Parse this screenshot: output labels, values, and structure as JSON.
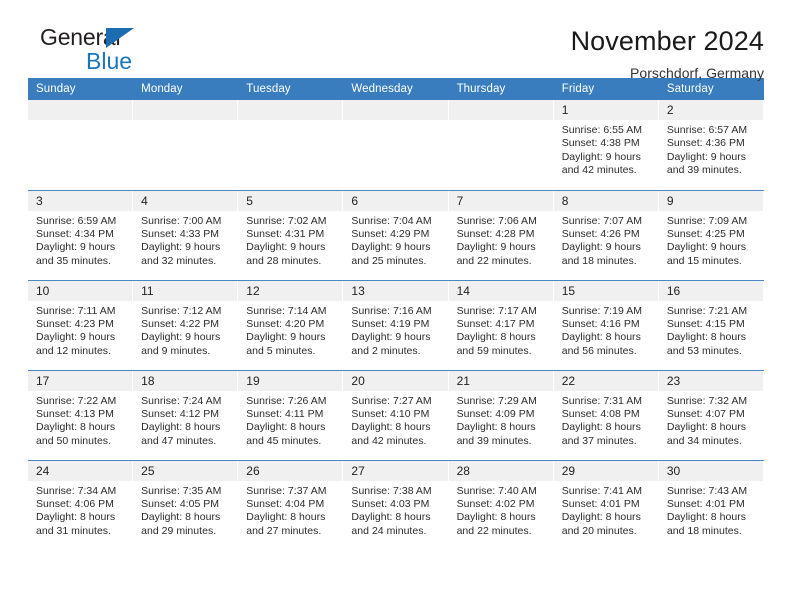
{
  "brand": {
    "name_top": "General",
    "name_bottom": "Blue",
    "accent_color": "#1b75bb"
  },
  "header": {
    "title": "November 2024",
    "subtitle": "Porschdorf, Germany"
  },
  "theme": {
    "header_row_bg": "#3a7dbe",
    "daynum_bg": "#f0f0f0",
    "row_divider": "#4a86c5",
    "text": "#222222"
  },
  "weekday_headers": [
    "Sunday",
    "Monday",
    "Tuesday",
    "Wednesday",
    "Thursday",
    "Friday",
    "Saturday"
  ],
  "labels": {
    "sunrise": "Sunrise:",
    "sunset": "Sunset:",
    "daylight": "Daylight:"
  },
  "weeks": [
    [
      {
        "day": "",
        "blank": true
      },
      {
        "day": "",
        "blank": true
      },
      {
        "day": "",
        "blank": true
      },
      {
        "day": "",
        "blank": true
      },
      {
        "day": "",
        "blank": true
      },
      {
        "day": "1",
        "sunrise": "Sunrise: 6:55 AM",
        "sunset": "Sunset: 4:38 PM",
        "daylight_1": "Daylight: 9 hours",
        "daylight_2": "and 42 minutes."
      },
      {
        "day": "2",
        "sunrise": "Sunrise: 6:57 AM",
        "sunset": "Sunset: 4:36 PM",
        "daylight_1": "Daylight: 9 hours",
        "daylight_2": "and 39 minutes."
      }
    ],
    [
      {
        "day": "3",
        "sunrise": "Sunrise: 6:59 AM",
        "sunset": "Sunset: 4:34 PM",
        "daylight_1": "Daylight: 9 hours",
        "daylight_2": "and 35 minutes."
      },
      {
        "day": "4",
        "sunrise": "Sunrise: 7:00 AM",
        "sunset": "Sunset: 4:33 PM",
        "daylight_1": "Daylight: 9 hours",
        "daylight_2": "and 32 minutes."
      },
      {
        "day": "5",
        "sunrise": "Sunrise: 7:02 AM",
        "sunset": "Sunset: 4:31 PM",
        "daylight_1": "Daylight: 9 hours",
        "daylight_2": "and 28 minutes."
      },
      {
        "day": "6",
        "sunrise": "Sunrise: 7:04 AM",
        "sunset": "Sunset: 4:29 PM",
        "daylight_1": "Daylight: 9 hours",
        "daylight_2": "and 25 minutes."
      },
      {
        "day": "7",
        "sunrise": "Sunrise: 7:06 AM",
        "sunset": "Sunset: 4:28 PM",
        "daylight_1": "Daylight: 9 hours",
        "daylight_2": "and 22 minutes."
      },
      {
        "day": "8",
        "sunrise": "Sunrise: 7:07 AM",
        "sunset": "Sunset: 4:26 PM",
        "daylight_1": "Daylight: 9 hours",
        "daylight_2": "and 18 minutes."
      },
      {
        "day": "9",
        "sunrise": "Sunrise: 7:09 AM",
        "sunset": "Sunset: 4:25 PM",
        "daylight_1": "Daylight: 9 hours",
        "daylight_2": "and 15 minutes."
      }
    ],
    [
      {
        "day": "10",
        "sunrise": "Sunrise: 7:11 AM",
        "sunset": "Sunset: 4:23 PM",
        "daylight_1": "Daylight: 9 hours",
        "daylight_2": "and 12 minutes."
      },
      {
        "day": "11",
        "sunrise": "Sunrise: 7:12 AM",
        "sunset": "Sunset: 4:22 PM",
        "daylight_1": "Daylight: 9 hours",
        "daylight_2": "and 9 minutes."
      },
      {
        "day": "12",
        "sunrise": "Sunrise: 7:14 AM",
        "sunset": "Sunset: 4:20 PM",
        "daylight_1": "Daylight: 9 hours",
        "daylight_2": "and 5 minutes."
      },
      {
        "day": "13",
        "sunrise": "Sunrise: 7:16 AM",
        "sunset": "Sunset: 4:19 PM",
        "daylight_1": "Daylight: 9 hours",
        "daylight_2": "and 2 minutes."
      },
      {
        "day": "14",
        "sunrise": "Sunrise: 7:17 AM",
        "sunset": "Sunset: 4:17 PM",
        "daylight_1": "Daylight: 8 hours",
        "daylight_2": "and 59 minutes."
      },
      {
        "day": "15",
        "sunrise": "Sunrise: 7:19 AM",
        "sunset": "Sunset: 4:16 PM",
        "daylight_1": "Daylight: 8 hours",
        "daylight_2": "and 56 minutes."
      },
      {
        "day": "16",
        "sunrise": "Sunrise: 7:21 AM",
        "sunset": "Sunset: 4:15 PM",
        "daylight_1": "Daylight: 8 hours",
        "daylight_2": "and 53 minutes."
      }
    ],
    [
      {
        "day": "17",
        "sunrise": "Sunrise: 7:22 AM",
        "sunset": "Sunset: 4:13 PM",
        "daylight_1": "Daylight: 8 hours",
        "daylight_2": "and 50 minutes."
      },
      {
        "day": "18",
        "sunrise": "Sunrise: 7:24 AM",
        "sunset": "Sunset: 4:12 PM",
        "daylight_1": "Daylight: 8 hours",
        "daylight_2": "and 47 minutes."
      },
      {
        "day": "19",
        "sunrise": "Sunrise: 7:26 AM",
        "sunset": "Sunset: 4:11 PM",
        "daylight_1": "Daylight: 8 hours",
        "daylight_2": "and 45 minutes."
      },
      {
        "day": "20",
        "sunrise": "Sunrise: 7:27 AM",
        "sunset": "Sunset: 4:10 PM",
        "daylight_1": "Daylight: 8 hours",
        "daylight_2": "and 42 minutes."
      },
      {
        "day": "21",
        "sunrise": "Sunrise: 7:29 AM",
        "sunset": "Sunset: 4:09 PM",
        "daylight_1": "Daylight: 8 hours",
        "daylight_2": "and 39 minutes."
      },
      {
        "day": "22",
        "sunrise": "Sunrise: 7:31 AM",
        "sunset": "Sunset: 4:08 PM",
        "daylight_1": "Daylight: 8 hours",
        "daylight_2": "and 37 minutes."
      },
      {
        "day": "23",
        "sunrise": "Sunrise: 7:32 AM",
        "sunset": "Sunset: 4:07 PM",
        "daylight_1": "Daylight: 8 hours",
        "daylight_2": "and 34 minutes."
      }
    ],
    [
      {
        "day": "24",
        "sunrise": "Sunrise: 7:34 AM",
        "sunset": "Sunset: 4:06 PM",
        "daylight_1": "Daylight: 8 hours",
        "daylight_2": "and 31 minutes."
      },
      {
        "day": "25",
        "sunrise": "Sunrise: 7:35 AM",
        "sunset": "Sunset: 4:05 PM",
        "daylight_1": "Daylight: 8 hours",
        "daylight_2": "and 29 minutes."
      },
      {
        "day": "26",
        "sunrise": "Sunrise: 7:37 AM",
        "sunset": "Sunset: 4:04 PM",
        "daylight_1": "Daylight: 8 hours",
        "daylight_2": "and 27 minutes."
      },
      {
        "day": "27",
        "sunrise": "Sunrise: 7:38 AM",
        "sunset": "Sunset: 4:03 PM",
        "daylight_1": "Daylight: 8 hours",
        "daylight_2": "and 24 minutes."
      },
      {
        "day": "28",
        "sunrise": "Sunrise: 7:40 AM",
        "sunset": "Sunset: 4:02 PM",
        "daylight_1": "Daylight: 8 hours",
        "daylight_2": "and 22 minutes."
      },
      {
        "day": "29",
        "sunrise": "Sunrise: 7:41 AM",
        "sunset": "Sunset: 4:01 PM",
        "daylight_1": "Daylight: 8 hours",
        "daylight_2": "and 20 minutes."
      },
      {
        "day": "30",
        "sunrise": "Sunrise: 7:43 AM",
        "sunset": "Sunset: 4:01 PM",
        "daylight_1": "Daylight: 8 hours",
        "daylight_2": "and 18 minutes."
      }
    ]
  ]
}
